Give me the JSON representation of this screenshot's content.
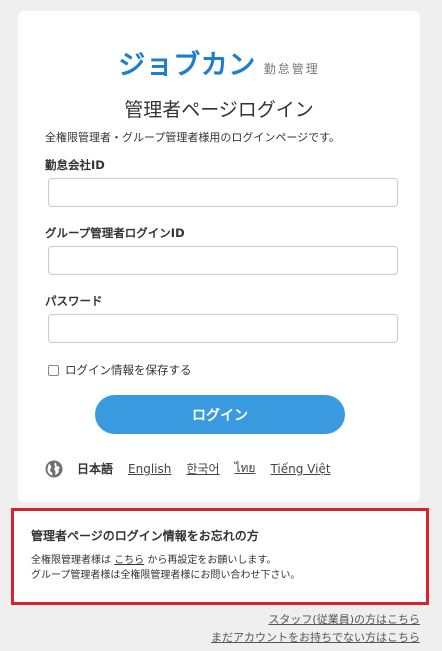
{
  "logo": {
    "main": "ジョブカン",
    "sub": "勤怠管理"
  },
  "page_title": "管理者ページログイン",
  "description": "全権限管理者・グループ管理者様用のログインページです。",
  "fields": {
    "company_id": {
      "label": "勤怠会社ID",
      "value": "",
      "placeholder": ""
    },
    "group_login_id": {
      "label": "グループ管理者ログインID",
      "value": "",
      "placeholder": ""
    },
    "password": {
      "label": "パスワード",
      "value": "",
      "placeholder": ""
    }
  },
  "remember_label": "ログイン情報を保存する",
  "login_button": "ログイン",
  "languages": {
    "icon": "globe-icon",
    "current": "日本語",
    "english": "English",
    "korean": "한국어",
    "thai": "ไทย",
    "vietnamese": "Tiếng Việt"
  },
  "forgot": {
    "title": "管理者ページのログイン情報をお忘れの方",
    "line1_prefix": "全権限管理者様は",
    "line1_link": "こちら",
    "line1_suffix": "から再設定をお願いします。",
    "line2": "グループ管理者様は全権限管理者様にお問い合わせ下さい。"
  },
  "footer": {
    "staff_link": "スタッフ(従業員)の方はこちら",
    "no_account_link": "まだアカウントをお持ちでない方はこちら"
  },
  "colors": {
    "brand": "#1c7ecc",
    "button": "#3a9ae0",
    "highlight_border": "#e0202c",
    "background": "#efefef"
  }
}
